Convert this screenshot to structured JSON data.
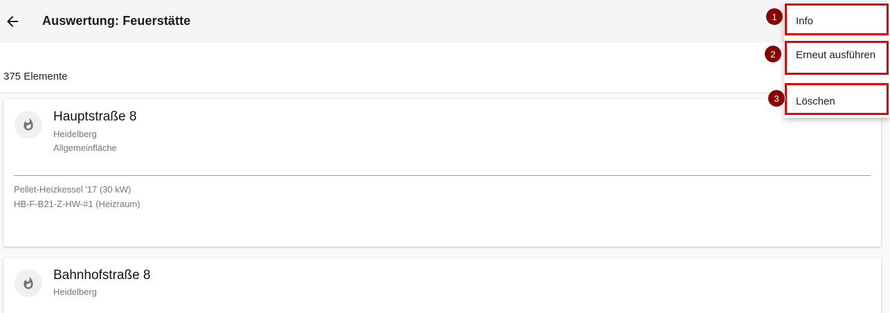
{
  "header": {
    "title": "Auswertung: Feuerstätte"
  },
  "list": {
    "count_label": "375 Elemente",
    "cards": [
      {
        "title": "Hauptstraße 8",
        "city": "Heidelberg",
        "area": "Allgemeinfläche",
        "detail_line1": "Pellet-Heizkessel '17 (30 kW)",
        "detail_line2": "HB-F-B21-Z-HW-#1 (Heizraum)",
        "icon": "flame-icon"
      },
      {
        "title": "Bahnhofstraße 8",
        "city": "Heidelberg",
        "icon": "flame-icon"
      }
    ]
  },
  "menu": {
    "items": [
      {
        "label": "Info",
        "marker": "1"
      },
      {
        "label": "Erneut ausführen",
        "marker": "2"
      },
      {
        "label": "Löschen",
        "marker": "3"
      }
    ]
  },
  "colors": {
    "highlight": "#e00000",
    "marker": "#8b0000",
    "appbar": "#f5f5f5"
  }
}
